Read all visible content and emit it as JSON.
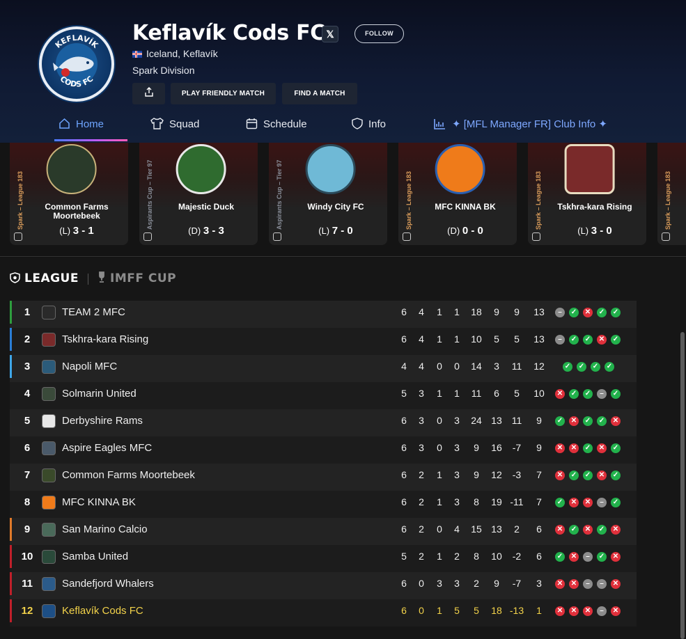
{
  "club": {
    "name": "Keflavík Cods FC",
    "location": "Iceland, Keflavík",
    "division": "Spark Division",
    "logo_text_top": "KEFLAVÍK",
    "logo_text_bottom": "CODS FC"
  },
  "header": {
    "x_label": "𝕏",
    "follow_label": "FOLLOW",
    "friendly_label": "PLAY FRIENDLY MATCH",
    "find_label": "FIND A MATCH"
  },
  "tabs": [
    {
      "label": "Home",
      "icon": "home-icon",
      "active": true
    },
    {
      "label": "Squad",
      "icon": "shirt-icon"
    },
    {
      "label": "Schedule",
      "icon": "calendar-icon"
    },
    {
      "label": "Info",
      "icon": "shield-icon"
    },
    {
      "label": "✦ [MFL Manager FR] Club Info ✦",
      "icon": "chart-icon"
    }
  ],
  "matches": [
    {
      "competition": "Spark – League 183",
      "type": "league",
      "opponent": "Common Farms Moortebeek",
      "result": "(L)",
      "score": "3 - 1",
      "crest_color": "#2a3a2a"
    },
    {
      "competition": "Aspirants Cup – Tier 97",
      "type": "cup",
      "opponent": "Majestic Duck",
      "result": "(D)",
      "score": "3 - 3",
      "crest_color": "#2f6b2f"
    },
    {
      "competition": "Aspirants Cup – Tier 97",
      "type": "cup",
      "opponent": "Windy City FC",
      "result": "(L)",
      "score": "7 - 0",
      "crest_color": "#6fb9d6"
    },
    {
      "competition": "Spark – League 183",
      "type": "league",
      "opponent": "MFC KINNA BK",
      "result": "(D)",
      "score": "0 - 0",
      "crest_color": "#ef7b1a"
    },
    {
      "competition": "Spark – League 183",
      "type": "league",
      "opponent": "Tskhra-kara Rising",
      "result": "(L)",
      "score": "3 - 0",
      "crest_color": "#7a2a2a"
    },
    {
      "competition": "Spark – League 183",
      "type": "league",
      "opponent": "",
      "result": "",
      "score": "",
      "crest_color": "#222"
    }
  ],
  "competition_tabs": {
    "league": "LEAGUE",
    "cup": "IMFF CUP"
  },
  "standings": [
    {
      "pos": "1",
      "team": "TEAM 2 MFC",
      "stats": [
        "6",
        "4",
        "1",
        "1",
        "18",
        "9",
        "9",
        "13"
      ],
      "form": [
        "D",
        "W",
        "L",
        "W",
        "W"
      ],
      "zone": "#2e9e3e",
      "badge": "#2a2a2a"
    },
    {
      "pos": "2",
      "team": "Tskhra-kara Rising",
      "stats": [
        "6",
        "4",
        "1",
        "1",
        "10",
        "5",
        "5",
        "13"
      ],
      "form": [
        "D",
        "W",
        "W",
        "L",
        "W"
      ],
      "zone": "#2a7ed6",
      "badge": "#7a2a2a"
    },
    {
      "pos": "3",
      "team": "Napoli MFC",
      "stats": [
        "4",
        "4",
        "0",
        "0",
        "14",
        "3",
        "11",
        "12"
      ],
      "form": [
        "W",
        "W",
        "W",
        "W"
      ],
      "zone": "#3fa6e8",
      "badge": "#2b5b7a"
    },
    {
      "pos": "4",
      "team": "Solmarin United",
      "stats": [
        "5",
        "3",
        "1",
        "1",
        "11",
        "6",
        "5",
        "10"
      ],
      "form": [
        "L",
        "W",
        "W",
        "D",
        "W"
      ],
      "zone": "",
      "badge": "#3a4a3a"
    },
    {
      "pos": "5",
      "team": "Derbyshire Rams",
      "stats": [
        "6",
        "3",
        "0",
        "3",
        "24",
        "13",
        "11",
        "9"
      ],
      "form": [
        "W",
        "L",
        "W",
        "W",
        "L"
      ],
      "zone": "",
      "badge": "#e8e8e8"
    },
    {
      "pos": "6",
      "team": "Aspire Eagles MFC",
      "stats": [
        "6",
        "3",
        "0",
        "3",
        "9",
        "16",
        "-7",
        "9"
      ],
      "form": [
        "L",
        "L",
        "W",
        "L",
        "W"
      ],
      "zone": "",
      "badge": "#4a5a6a"
    },
    {
      "pos": "7",
      "team": "Common Farms Moortebeek",
      "stats": [
        "6",
        "2",
        "1",
        "3",
        "9",
        "12",
        "-3",
        "7"
      ],
      "form": [
        "L",
        "W",
        "W",
        "L",
        "W"
      ],
      "zone": "",
      "badge": "#3a4a2a"
    },
    {
      "pos": "8",
      "team": "MFC KINNA BK",
      "stats": [
        "6",
        "2",
        "1",
        "3",
        "8",
        "19",
        "-11",
        "7"
      ],
      "form": [
        "W",
        "L",
        "L",
        "D",
        "W"
      ],
      "zone": "",
      "badge": "#ef7b1a"
    },
    {
      "pos": "9",
      "team": "San Marino Calcio",
      "stats": [
        "6",
        "2",
        "0",
        "4",
        "15",
        "13",
        "2",
        "6"
      ],
      "form": [
        "L",
        "W",
        "L",
        "W",
        "L"
      ],
      "zone": "#e07a2a",
      "badge": "#4a6a5a"
    },
    {
      "pos": "10",
      "team": "Samba United",
      "stats": [
        "5",
        "2",
        "1",
        "2",
        "8",
        "10",
        "-2",
        "6"
      ],
      "form": [
        "W",
        "L",
        "D",
        "W",
        "L"
      ],
      "zone": "#c0202a",
      "badge": "#2a4a3a"
    },
    {
      "pos": "11",
      "team": "Sandefjord Whalers",
      "stats": [
        "6",
        "0",
        "3",
        "3",
        "2",
        "9",
        "-7",
        "3"
      ],
      "form": [
        "L",
        "L",
        "D",
        "D",
        "L"
      ],
      "zone": "#c0202a",
      "badge": "#2b5b8a"
    },
    {
      "pos": "12",
      "team": "Keflavík Cods FC",
      "stats": [
        "6",
        "0",
        "1",
        "5",
        "5",
        "18",
        "-13",
        "1"
      ],
      "form": [
        "L",
        "L",
        "L",
        "D",
        "L"
      ],
      "zone": "#c0202a",
      "badge": "#1d4f86",
      "me": true
    }
  ],
  "colors": {
    "accent": "#6ea5ff",
    "win": "#22b24c",
    "loss": "#e0303b",
    "draw": "#8c8c8c",
    "highlight": "#f2d24a"
  }
}
